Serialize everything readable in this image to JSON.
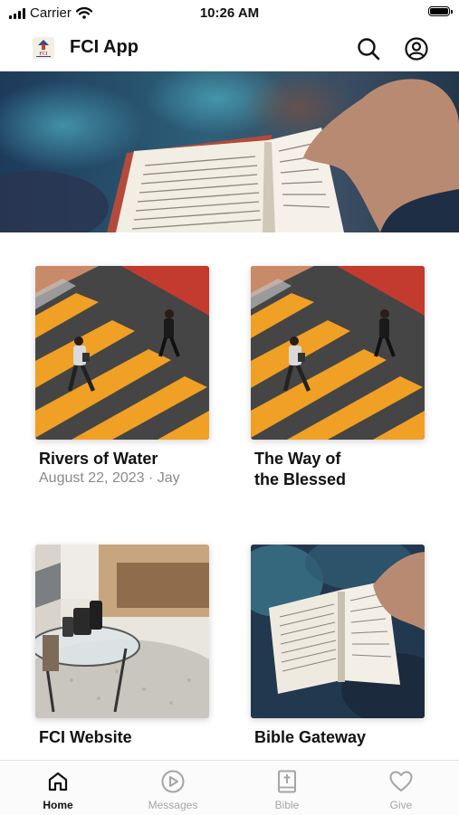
{
  "status_bar": {
    "carrier": "Carrier",
    "time": "10:26 AM"
  },
  "header": {
    "title": "FCI App",
    "logo_text": "FCI",
    "search_icon": "search-icon",
    "profile_icon": "user-circle-icon"
  },
  "hero": {
    "image": "open-bible-photo"
  },
  "cards": [
    {
      "title_line1": "Rivers of Water",
      "title_line2": "",
      "subtitle": "August 22, 2023 · Jay",
      "image": "crosswalk-photo"
    },
    {
      "title_line1": "The Way of",
      "title_line2": "the Blessed",
      "subtitle": "",
      "image": "crosswalk-photo"
    },
    {
      "title_line1": "FCI Website",
      "title_line2": "",
      "subtitle": "",
      "image": "living-room-photo"
    },
    {
      "title_line1": "Bible Gateway",
      "title_line2": "",
      "subtitle": "",
      "image": "open-bible-photo"
    }
  ],
  "tabbar": {
    "tabs": [
      {
        "label": "Home",
        "icon": "home-icon",
        "active": true
      },
      {
        "label": "Messages",
        "icon": "play-circle-icon",
        "active": false
      },
      {
        "label": "Bible",
        "icon": "bible-icon",
        "active": false
      },
      {
        "label": "Give",
        "icon": "heart-icon",
        "active": false
      }
    ]
  },
  "colors": {
    "text": "#111111",
    "muted": "#8a8a8a",
    "tab_inactive": "#a5a5a5",
    "crosswalk_orange": "#f0a024",
    "asphalt": "#454545"
  }
}
